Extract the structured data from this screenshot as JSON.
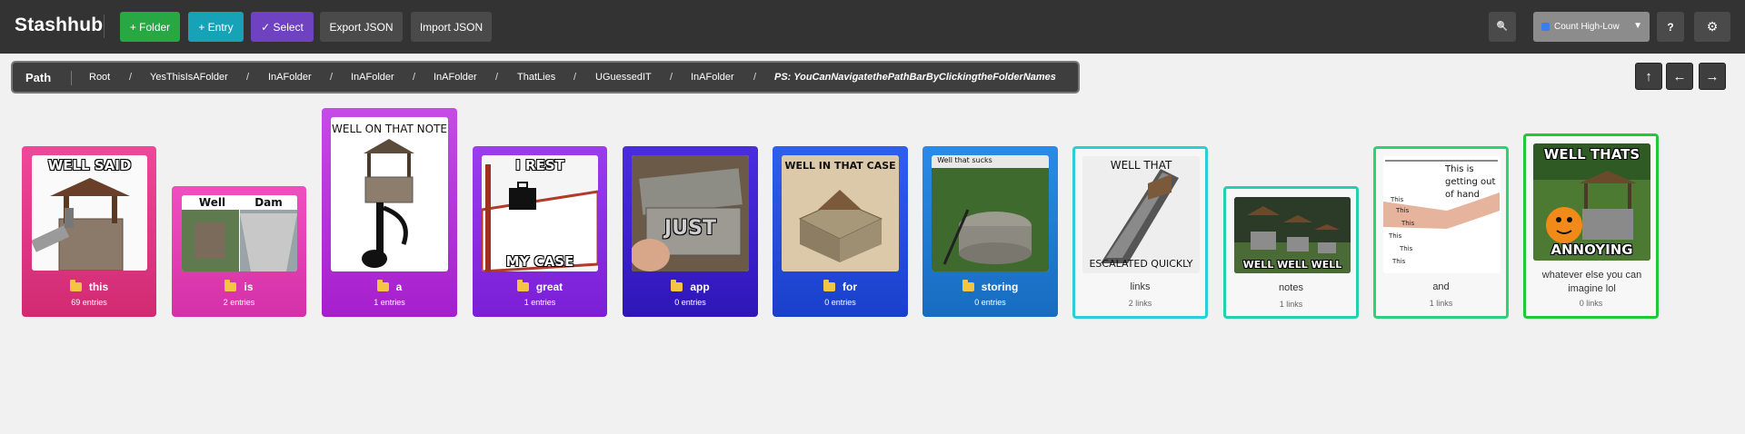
{
  "app": {
    "title": "Stashhub"
  },
  "toolbar": {
    "add_folder": "+ Folder",
    "add_entry": "+ Entry",
    "select": "✓ Select",
    "export": "Export JSON",
    "import": "Import JSON",
    "search_icon": "🔍",
    "sort_label": "Count High-Low",
    "help": "?",
    "settings_icon": "⚙"
  },
  "path": {
    "label": "Path",
    "crumbs": [
      "Root",
      "YesThisIsAFolder",
      "InAFolder",
      "InAFolder",
      "InAFolder",
      "ThatLies",
      "UGuessedIT",
      "InAFolder",
      "PS: YouCanNavigatethePathBarByClickingtheFolderNames"
    ],
    "separator": "/"
  },
  "nav": {
    "up": "↑",
    "back": "←",
    "forward": "→"
  },
  "cards": [
    {
      "type": "folder",
      "title": "this",
      "count": "69 entries",
      "color": "#e0347f",
      "caption": "WELL SAID"
    },
    {
      "type": "folder",
      "title": "is",
      "count": "2 entries",
      "color": "#e440b0",
      "caption_left": "Well",
      "caption_right": "Dam"
    },
    {
      "type": "folder",
      "title": "a",
      "count": "1 entries",
      "color": "#b52fd8",
      "caption": "WELL ON THAT NOTE"
    },
    {
      "type": "folder",
      "title": "great",
      "count": "1 entries",
      "color": "#8a2be2",
      "caption_top": "I REST",
      "caption_bottom": "MY CASE"
    },
    {
      "type": "folder",
      "title": "app",
      "count": "0 entries",
      "color": "#3a1fcc",
      "caption": "JUST"
    },
    {
      "type": "folder",
      "title": "for",
      "count": "0 entries",
      "color": "#2349d6",
      "caption": "WELL IN THAT CASE"
    },
    {
      "type": "folder",
      "title": "storing",
      "count": "0 entries",
      "color": "#1f78d1",
      "caption": "Well that sucks"
    },
    {
      "type": "link",
      "title": "links",
      "count": "2 links",
      "border": "#2ad0d8",
      "caption_top": "WELL THAT",
      "caption_bottom": "ESCALATED QUICKLY"
    },
    {
      "type": "link",
      "title": "notes",
      "count": "1 links",
      "border": "#22d1b0",
      "caption": "WELL WELL WELL"
    },
    {
      "type": "link",
      "title": "and",
      "count": "1 links",
      "border": "#2bd27a",
      "caption": "This is getting out of hand"
    },
    {
      "type": "link",
      "title": "whatever else you can imagine lol",
      "count": "0 links",
      "border": "#1fc93a",
      "caption_top": "WELL THATS",
      "caption_bottom": "ANNOYING"
    }
  ]
}
